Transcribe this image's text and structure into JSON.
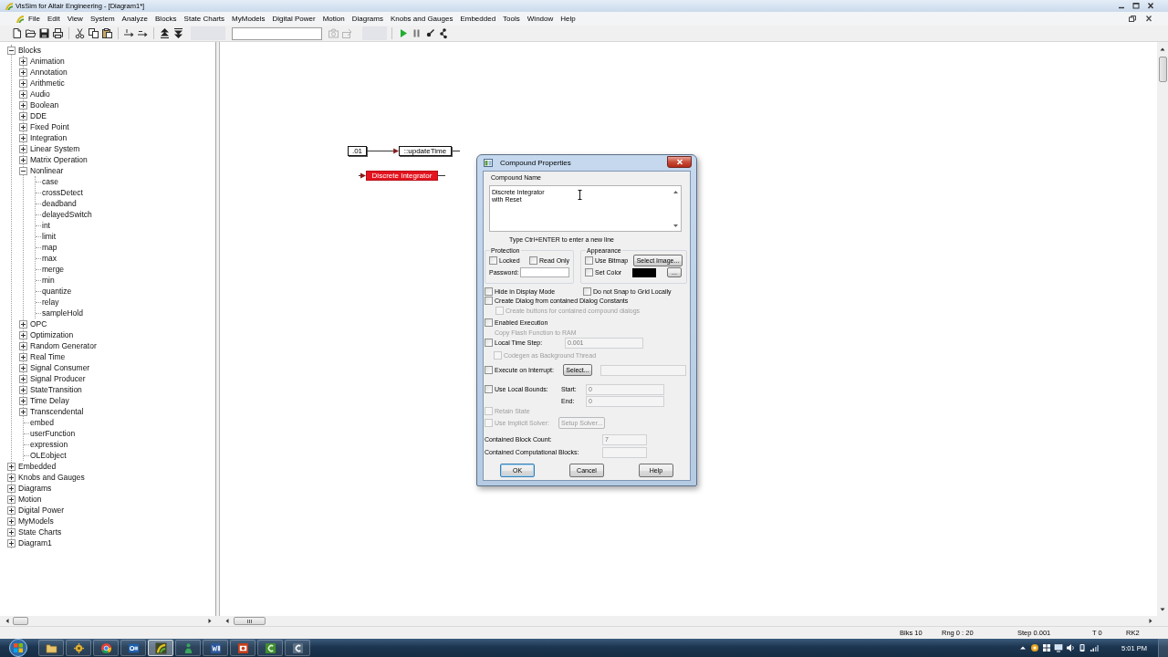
{
  "window": {
    "title": "VisSim for Altair Engineering - [Diagram1*]"
  },
  "menu": [
    "File",
    "Edit",
    "View",
    "System",
    "Analyze",
    "Blocks",
    "State Charts",
    "MyModels",
    "Digital Power",
    "Motion",
    "Diagrams",
    "Knobs and Gauges",
    "Embedded",
    "Tools",
    "Window",
    "Help"
  ],
  "tree": [
    {
      "label": "Blocks",
      "expanded": true,
      "children": [
        {
          "label": "Animation",
          "expanded": false
        },
        {
          "label": "Annotation",
          "expanded": false
        },
        {
          "label": "Arithmetic",
          "expanded": false
        },
        {
          "label": "Audio",
          "expanded": false
        },
        {
          "label": "Boolean",
          "expanded": false
        },
        {
          "label": "DDE",
          "expanded": false
        },
        {
          "label": "Fixed Point",
          "expanded": false
        },
        {
          "label": "Integration",
          "expanded": false
        },
        {
          "label": "Linear System",
          "expanded": false
        },
        {
          "label": "Matrix Operation",
          "expanded": false
        },
        {
          "label": "Nonlinear",
          "expanded": true,
          "children": [
            {
              "label": "case"
            },
            {
              "label": "crossDetect"
            },
            {
              "label": "deadband"
            },
            {
              "label": "delayedSwitch"
            },
            {
              "label": "int"
            },
            {
              "label": "limit"
            },
            {
              "label": "map"
            },
            {
              "label": "max"
            },
            {
              "label": "merge"
            },
            {
              "label": "min"
            },
            {
              "label": "quantize"
            },
            {
              "label": "relay"
            },
            {
              "label": "sampleHold"
            }
          ]
        },
        {
          "label": "OPC",
          "expanded": false
        },
        {
          "label": "Optimization",
          "expanded": false
        },
        {
          "label": "Random Generator",
          "expanded": false
        },
        {
          "label": "Real Time",
          "expanded": false
        },
        {
          "label": "Signal Consumer",
          "expanded": false
        },
        {
          "label": "Signal Producer",
          "expanded": false
        },
        {
          "label": "StateTransition",
          "expanded": false
        },
        {
          "label": "Time Delay",
          "expanded": false
        },
        {
          "label": "Transcendental",
          "expanded": false
        },
        {
          "label": "embed"
        },
        {
          "label": "userFunction"
        },
        {
          "label": "expression"
        },
        {
          "label": "OLEobject"
        }
      ]
    },
    {
      "label": "Embedded",
      "expanded": false
    },
    {
      "label": "Knobs and Gauges",
      "expanded": false
    },
    {
      "label": "Diagrams",
      "expanded": false
    },
    {
      "label": "Motion",
      "expanded": false
    },
    {
      "label": "Digital Power",
      "expanded": false
    },
    {
      "label": "MyModels",
      "expanded": false
    },
    {
      "label": "State Charts",
      "expanded": false
    },
    {
      "label": "Diagram1",
      "expanded": false
    }
  ],
  "diagram": {
    "blocks": [
      {
        "label": ".01",
        "selected": false
      },
      {
        "label": "::updateTime",
        "selected": false
      },
      {
        "label": "Discrete Integrator",
        "selected": true
      }
    ]
  },
  "dialog": {
    "title": "Compound Properties",
    "name_label": "Compound Name",
    "name_value": "Discrete Integrator\nwith Reset",
    "hint": "Type Ctrl+ENTER to enter a new line",
    "protection": {
      "title": "Protection",
      "locked": {
        "label": "Locked",
        "checked": false,
        "disabled": false
      },
      "read_only": {
        "label": "Read Only",
        "checked": false,
        "disabled": false
      },
      "password_label": "Password:"
    },
    "appearance": {
      "title": "Appearance",
      "use_bitmap": {
        "label": "Use Bitmap",
        "checked": false,
        "disabled": false
      },
      "select_image": "Select Image...",
      "set_color": {
        "label": "Set Color",
        "checked": false,
        "disabled": false
      },
      "swatch": {
        "color": "#000000"
      },
      "browse": "..."
    },
    "hide_in_display_mode": {
      "label": "Hide in Display Mode",
      "checked": false,
      "disabled": false
    },
    "no_snap": {
      "label": "Do not Snap to Grid Locally",
      "checked": false,
      "disabled": false
    },
    "create_dialog": {
      "label": "Create Dialog from contained Dialog Constants",
      "checked": false,
      "disabled": false
    },
    "create_buttons": {
      "label": "Create buttons for contained compound dialogs",
      "checked": false,
      "disabled": true
    },
    "enabled_execution": {
      "label": "Enabled Execution",
      "checked": false,
      "disabled": false
    },
    "copy_flash": {
      "label": "Copy Flash Function to RAM",
      "disabled": true
    },
    "local_time_step": {
      "label": "Local Time Step:",
      "checked": false,
      "disabled": false,
      "field": {
        "value": "0.001",
        "disabled": true
      }
    },
    "codegen": {
      "label": "Codegen as Background Thread",
      "checked": false,
      "disabled": true
    },
    "execute_on_interrupt": {
      "label": "Execute on Interrupt:",
      "checked": false,
      "disabled": false,
      "button": "Select...",
      "field": {
        "disabled": true
      }
    },
    "local_bounds": {
      "label": "Use Local Bounds:",
      "checked": false,
      "disabled": false,
      "start_label": "Start:",
      "start": {
        "value": "0",
        "disabled": true
      },
      "end_label": "End:",
      "end": {
        "value": "0",
        "disabled": true
      }
    },
    "retain_state": {
      "label": "Retain State",
      "checked": false,
      "disabled": true
    },
    "implicit_solver": {
      "label": "Use Implicit Solver:",
      "checked": false,
      "disabled": true,
      "button": "Setup Solver..."
    },
    "block_count": {
      "label": "Contained Block Count:",
      "field": {
        "value": "7",
        "disabled": true
      }
    },
    "computational_blocks": {
      "label": "Contained Computational Blocks:",
      "field": {
        "disabled": true
      }
    },
    "buttons": [
      {
        "label": "OK",
        "default": true
      },
      {
        "label": "Cancel",
        "default": false
      },
      {
        "label": "Help",
        "default": false
      }
    ]
  },
  "status_bar": [
    "Blks 10",
    "Rng 0 : 20",
    "Step 0.001",
    "T 0",
    "RK2"
  ],
  "taskbar": {
    "apps": [
      {
        "selected": false
      },
      {
        "selected": false
      },
      {
        "selected": false
      },
      {
        "selected": false
      },
      {
        "selected": true
      },
      {
        "selected": false
      },
      {
        "selected": false
      },
      {
        "selected": false
      },
      {
        "selected": false
      },
      {
        "selected": false
      }
    ],
    "clock": "5:01 PM"
  }
}
